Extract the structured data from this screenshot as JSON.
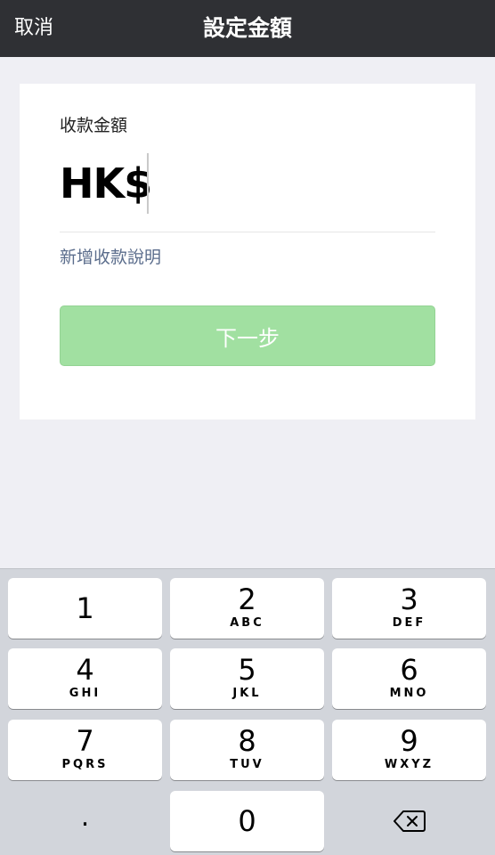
{
  "nav": {
    "cancel": "取消",
    "title": "設定金額"
  },
  "form": {
    "amount_label": "收款金額",
    "currency": "HK$",
    "amount_value": "",
    "add_description": "新增收款說明",
    "next_button": "下一步"
  },
  "keypad": {
    "keys": [
      {
        "num": "1",
        "letters": ""
      },
      {
        "num": "2",
        "letters": "ABC"
      },
      {
        "num": "3",
        "letters": "DEF"
      },
      {
        "num": "4",
        "letters": "GHI"
      },
      {
        "num": "5",
        "letters": "JKL"
      },
      {
        "num": "6",
        "letters": "MNO"
      },
      {
        "num": "7",
        "letters": "PQRS"
      },
      {
        "num": "8",
        "letters": "TUV"
      },
      {
        "num": "9",
        "letters": "WXYZ"
      },
      {
        "num": ".",
        "letters": ""
      },
      {
        "num": "0",
        "letters": ""
      }
    ],
    "backspace_icon": "backspace-icon"
  },
  "colors": {
    "navbar": "#2f3034",
    "button_disabled_green": "#a1e0a1",
    "link_blue": "#5b6d8c",
    "keypad_bg": "#d2d5db"
  }
}
